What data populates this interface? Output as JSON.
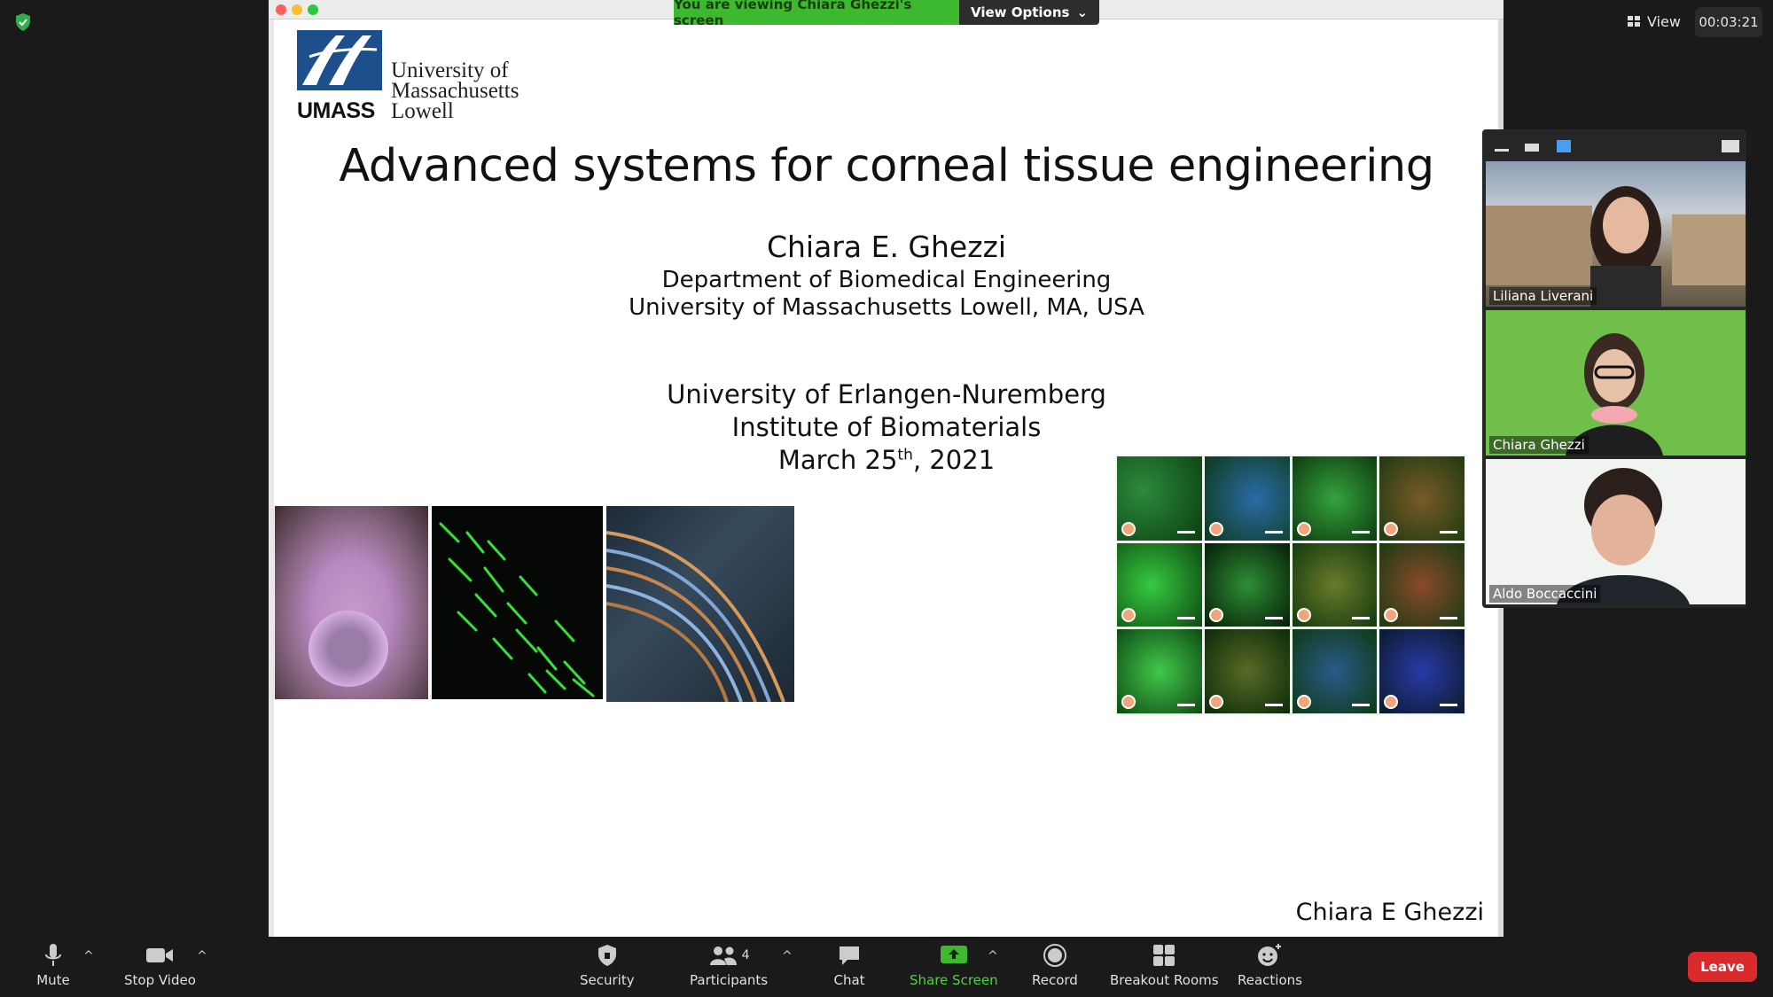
{
  "meeting": {
    "view_label": "View",
    "timer": "00:03:21",
    "viewing_banner": "You are viewing Chiara Ghezzi's screen",
    "view_options_label": "View Options"
  },
  "slide": {
    "logo_text": "UMASS",
    "university_lines": [
      "University of",
      "Massachusetts",
      "Lowell"
    ],
    "title": "Advanced systems for corneal tissue engineering",
    "author": "Chiara E. Ghezzi",
    "department": "Department of Biomedical Engineering",
    "affiliation": "University of Massachusetts Lowell, MA, USA",
    "host_institution": "University of Erlangen-Nuremberg",
    "host_institute": "Institute of Biomaterials",
    "date_prefix": "March 25",
    "date_sup": "th",
    "date_suffix": ", 2021",
    "footer_name": "Chiara E Ghezzi"
  },
  "participants": [
    {
      "name": "Liliana Liverani",
      "background": "#7d8a9a"
    },
    {
      "name": "Chiara Ghezzi",
      "background": "#6fbf4a"
    },
    {
      "name": "Aldo Boccaccini",
      "background": "#f0f3ef"
    }
  ],
  "toolbar": {
    "mute": "Mute",
    "stop_video": "Stop Video",
    "security": "Security",
    "participants": "Participants",
    "participants_count": "4",
    "chat": "Chat",
    "share_screen": "Share Screen",
    "record": "Record",
    "breakout_rooms": "Breakout Rooms",
    "reactions": "Reactions",
    "leave": "Leave"
  },
  "colors": {
    "share_accent": "#3cb92f",
    "leave": "#d92b2b",
    "umass_blue": "#1d4f8c"
  }
}
